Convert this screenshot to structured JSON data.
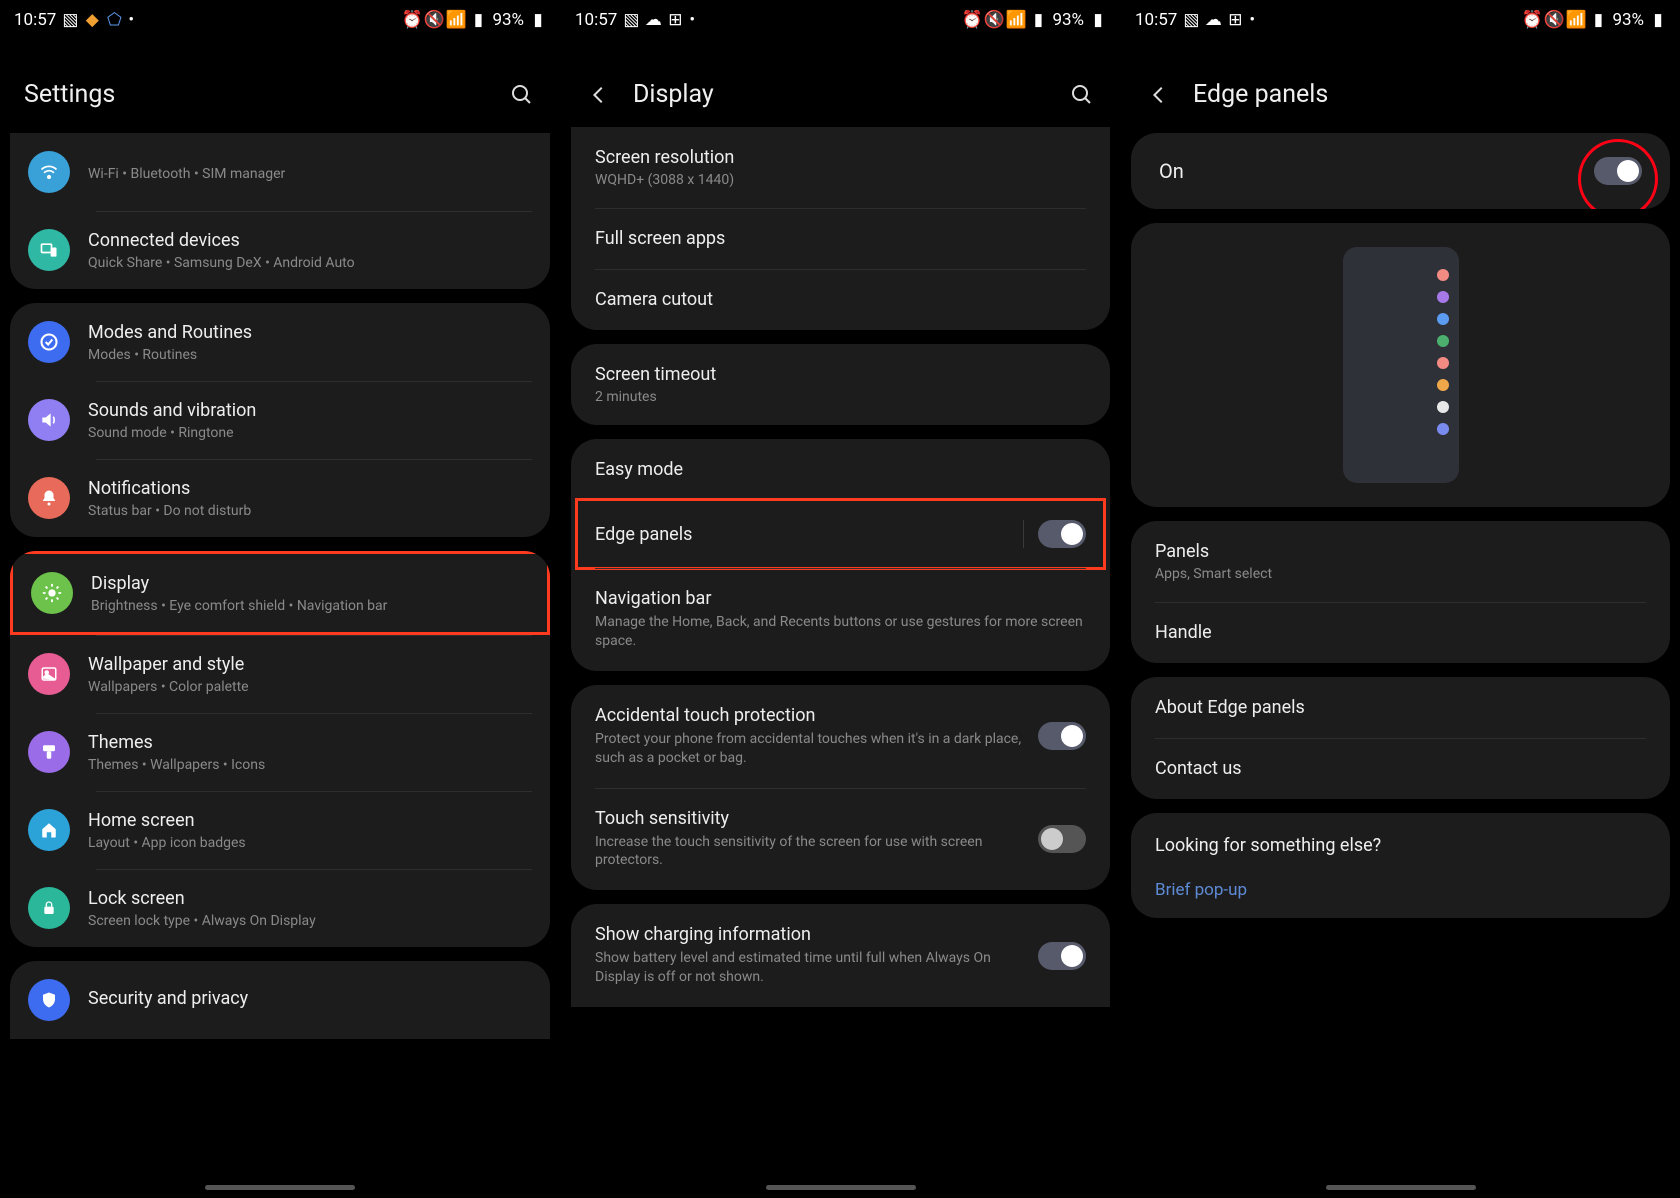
{
  "status": {
    "time": "10:57",
    "battery": "93%"
  },
  "panel1": {
    "title": "Settings",
    "groups": [
      {
        "cutTop": true,
        "items": [
          {
            "id": "connections",
            "title": "",
            "sub": "Wi-Fi  •  Bluetooth  •  SIM manager",
            "color": "#3aa0d8",
            "glyph": "wifi"
          },
          {
            "id": "connected-devices",
            "title": "Connected devices",
            "sub": "Quick Share  •  Samsung DeX  •  Android Auto",
            "color": "#2fb8a3",
            "glyph": "devices"
          }
        ]
      },
      {
        "items": [
          {
            "id": "modes-routines",
            "title": "Modes and Routines",
            "sub": "Modes  •  Routines",
            "color": "#3d6cf0",
            "glyph": "check"
          },
          {
            "id": "sounds",
            "title": "Sounds and vibration",
            "sub": "Sound mode  •  Ringtone",
            "color": "#8f7ff2",
            "glyph": "sound"
          },
          {
            "id": "notifications",
            "title": "Notifications",
            "sub": "Status bar  •  Do not disturb",
            "color": "#e86a5a",
            "glyph": "bell"
          }
        ]
      },
      {
        "items": [
          {
            "id": "display",
            "title": "Display",
            "sub": "Brightness  •  Eye comfort shield  •  Navigation bar",
            "color": "#6cc24a",
            "glyph": "brightness",
            "highlighted": true
          },
          {
            "id": "wallpaper",
            "title": "Wallpaper and style",
            "sub": "Wallpapers  •  Color palette",
            "color": "#e85c94",
            "glyph": "image"
          },
          {
            "id": "themes",
            "title": "Themes",
            "sub": "Themes  •  Wallpapers  •  Icons",
            "color": "#9a6ce8",
            "glyph": "brush"
          },
          {
            "id": "home-screen",
            "title": "Home screen",
            "sub": "Layout  •  App icon badges",
            "color": "#2ba3d9",
            "glyph": "home"
          },
          {
            "id": "lock-screen",
            "title": "Lock screen",
            "sub": "Screen lock type  •  Always On Display",
            "color": "#2bb89a",
            "glyph": "lock"
          }
        ]
      },
      {
        "cutBottom": true,
        "items": [
          {
            "id": "security",
            "title": "Security and privacy",
            "sub": "",
            "color": "#3d6cf0",
            "glyph": "shield"
          }
        ]
      }
    ]
  },
  "panel2": {
    "title": "Display",
    "groups": [
      {
        "cutTop": true,
        "items": [
          {
            "id": "resolution",
            "title": "Screen resolution",
            "value": "WQHD+ (3088 x 1440)"
          },
          {
            "id": "fullscreen-apps",
            "title": "Full screen apps"
          },
          {
            "id": "camera-cutout",
            "title": "Camera cutout"
          }
        ]
      },
      {
        "items": [
          {
            "id": "screen-timeout",
            "title": "Screen timeout",
            "value": "2 minutes"
          }
        ]
      },
      {
        "items": [
          {
            "id": "easy-mode",
            "title": "Easy mode"
          },
          {
            "id": "edge-panels",
            "title": "Edge panels",
            "toggle": true,
            "on": true,
            "highlighted": true
          },
          {
            "id": "navigation-bar",
            "title": "Navigation bar",
            "desc": "Manage the Home, Back, and Recents buttons or use gestures for more screen space."
          }
        ]
      },
      {
        "items": [
          {
            "id": "accidental-touch",
            "title": "Accidental touch protection",
            "desc": "Protect your phone from accidental touches when it's in a dark place, such as a pocket or bag.",
            "toggle": true,
            "on": true
          },
          {
            "id": "touch-sensitivity",
            "title": "Touch sensitivity",
            "desc": "Increase the touch sensitivity of the screen for use with screen protectors.",
            "toggle": true,
            "on": false
          }
        ]
      },
      {
        "cutBottom": true,
        "items": [
          {
            "id": "charging-info",
            "title": "Show charging information",
            "desc": "Show battery level and estimated time until full when Always On Display is off or not shown.",
            "toggle": true,
            "on": true
          }
        ]
      }
    ]
  },
  "panel3": {
    "title": "Edge panels",
    "masterToggle": {
      "label": "On",
      "on": true,
      "circled": true
    },
    "previewDots": [
      "#f28b82",
      "#a779e8",
      "#5b9bf0",
      "#4caf6d",
      "#f28b82",
      "#f0a74a",
      "#e8e8e8",
      "#7a8bf0"
    ],
    "groups": [
      {
        "items": [
          {
            "id": "panels",
            "title": "Panels",
            "value": "Apps, Smart select"
          },
          {
            "id": "handle",
            "title": "Handle"
          }
        ]
      },
      {
        "items": [
          {
            "id": "about",
            "title": "About Edge panels"
          },
          {
            "id": "contact",
            "title": "Contact us"
          }
        ]
      }
    ],
    "lookingFor": {
      "heading": "Looking for something else?",
      "links": [
        "Brief pop-up"
      ]
    }
  }
}
